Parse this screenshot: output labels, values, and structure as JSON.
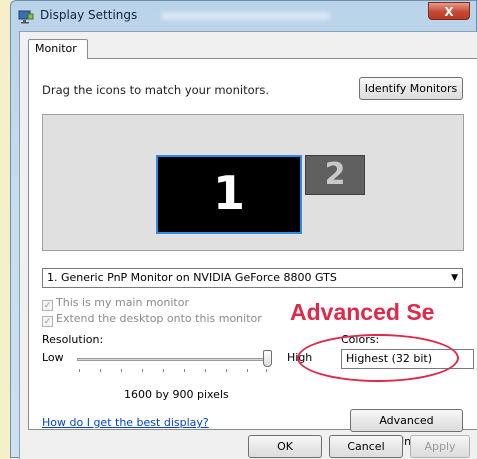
{
  "window": {
    "title": "Display Settings",
    "close_label": "X"
  },
  "tabs": [
    {
      "label": "Monitor"
    }
  ],
  "panel": {
    "instruction": "Drag the icons to match your monitors.",
    "identify_label": "Identify Monitors",
    "monitors": [
      {
        "number": "1"
      },
      {
        "number": "2"
      }
    ],
    "monitor_select": "1. Generic PnP Monitor on NVIDIA GeForce 8800 GTS",
    "main_monitor_label": "This is my main monitor",
    "extend_label": "Extend the desktop onto this monitor",
    "checkbox_mark": "✓",
    "resolution_label": "Resolution:",
    "low_label": "Low",
    "high_label": "High",
    "resolution_value": "1600 by 900 pixels",
    "resolution_slider_level": 1.0,
    "colors_label": "Colors:",
    "colors_value": "Highest (32 bit)",
    "help_link": "How do I get the best display?",
    "advanced_label": "Advanced Settings..."
  },
  "footer": {
    "ok_label": "OK",
    "cancel_label": "Cancel",
    "apply_label": "Apply"
  },
  "annotation": {
    "text": "Advanced Se",
    "color": "#e0284a"
  },
  "colors": {
    "page_background": "#f6f0c8",
    "selected_monitor_border": "#2a8ee6",
    "close_button": "#c64932",
    "link": "#0044cc"
  }
}
